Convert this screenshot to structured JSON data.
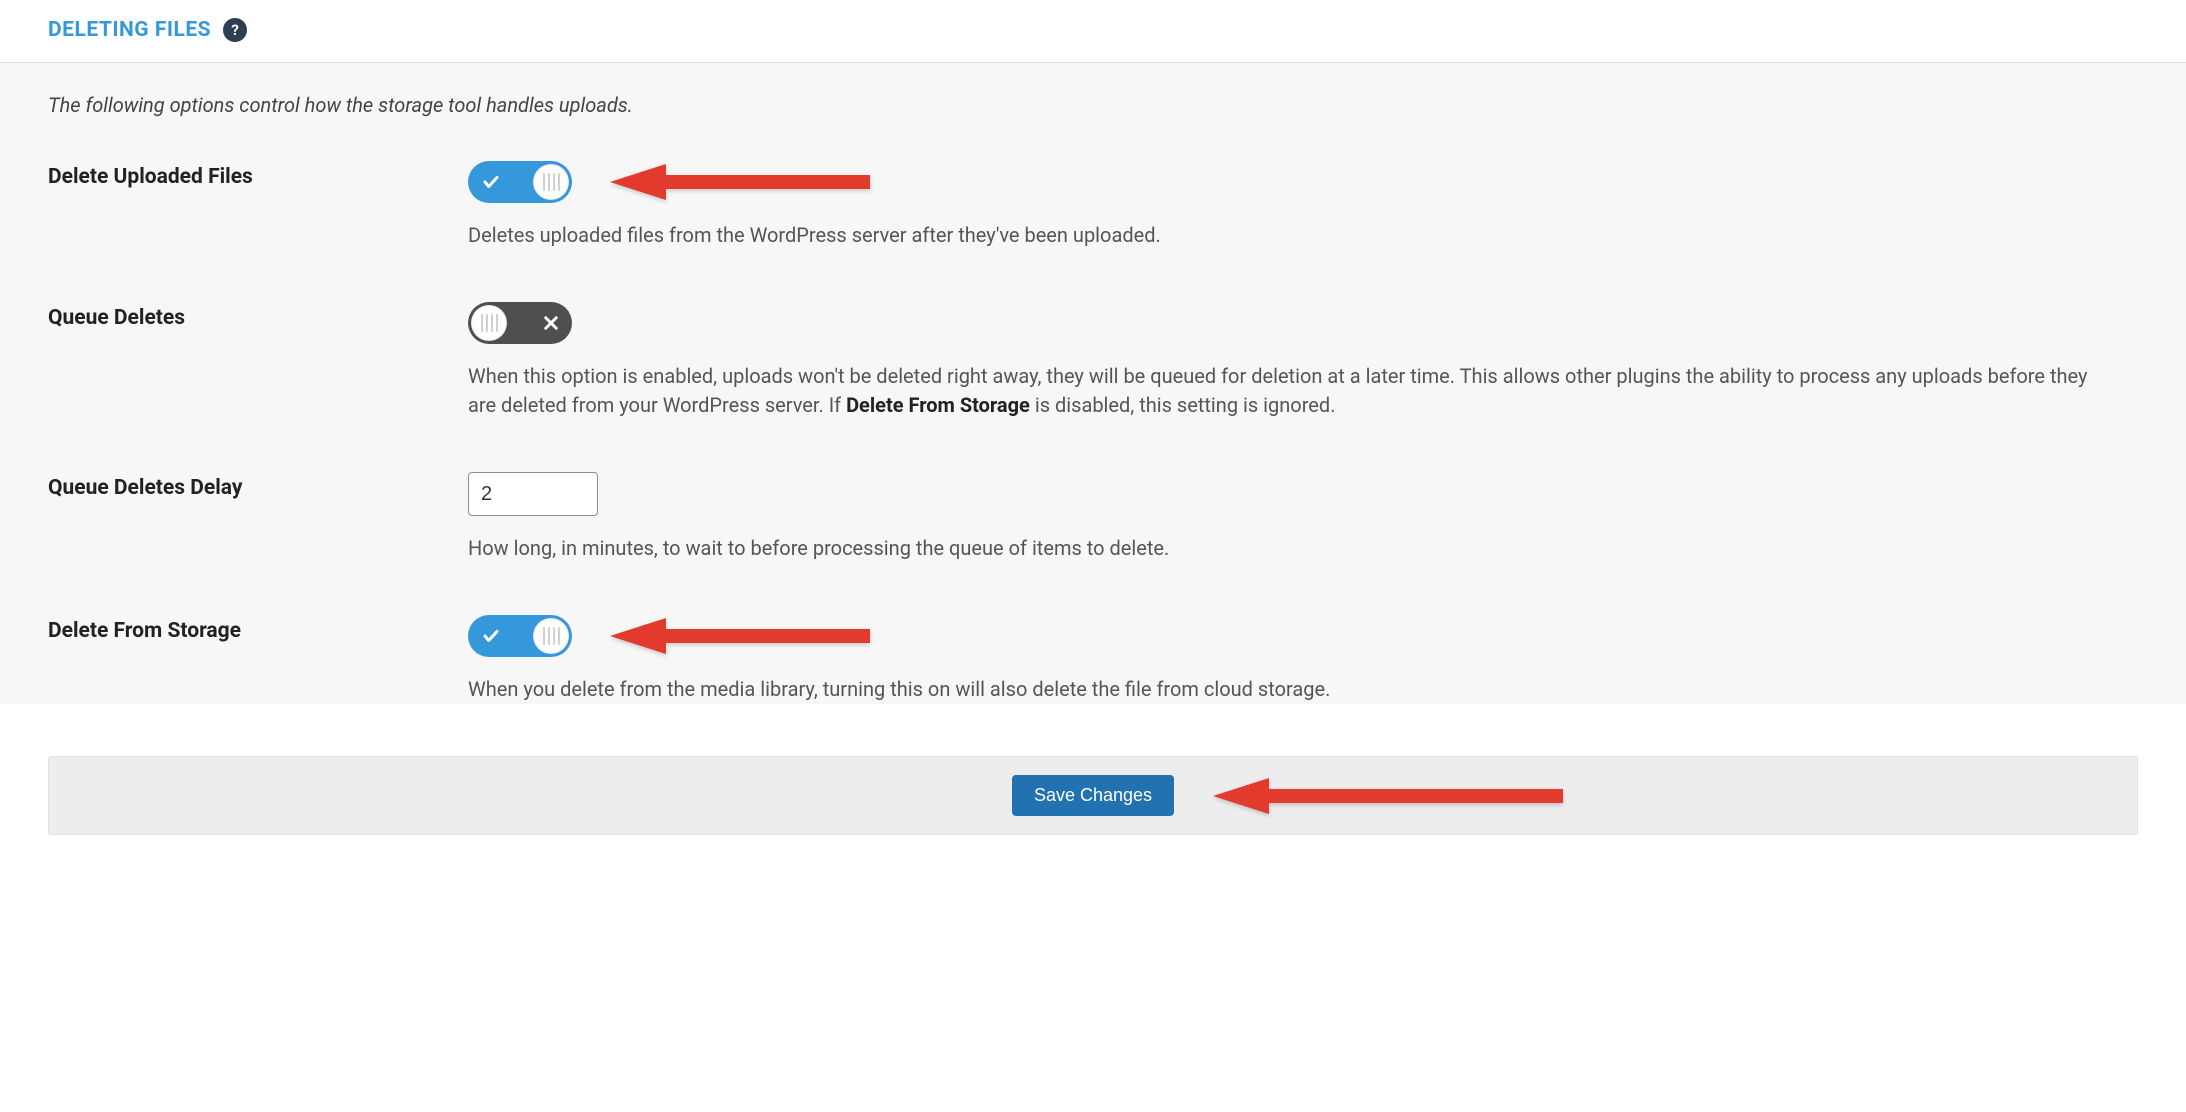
{
  "section": {
    "title": "DELETING FILES"
  },
  "intro": "The following options control how the storage tool handles uploads.",
  "fields": {
    "delete_uploaded": {
      "label": "Delete Uploaded Files",
      "on": true,
      "help": "Deletes uploaded files from the WordPress server after they've been uploaded."
    },
    "queue_deletes": {
      "label": "Queue Deletes",
      "on": false,
      "help_pre": "When this option is enabled, uploads won't be deleted right away, they will be queued for deletion at a later time. This allows other plugins the ability to process any uploads before they are deleted from your WordPress server. If ",
      "help_strong": "Delete From Storage",
      "help_post": " is disabled, this setting is ignored."
    },
    "queue_delay": {
      "label": "Queue Deletes Delay",
      "value": "2",
      "help": "How long, in minutes, to wait to before processing the queue of items to delete."
    },
    "delete_from_storage": {
      "label": "Delete From Storage",
      "on": true,
      "help": "When you delete from the media library, turning this on will also delete the file from cloud storage."
    }
  },
  "footer": {
    "save_label": "Save Changes"
  }
}
